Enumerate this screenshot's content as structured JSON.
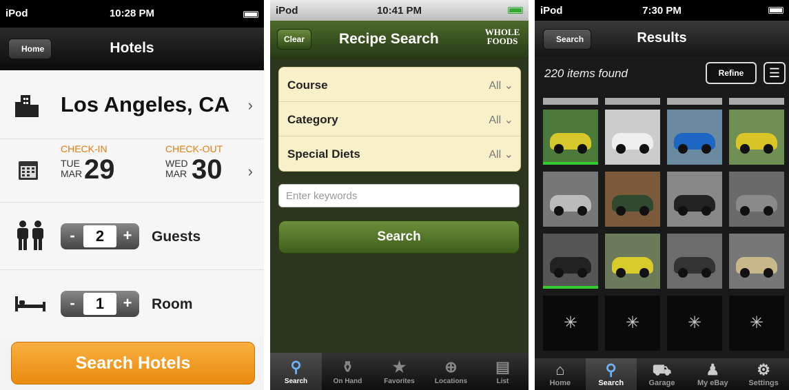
{
  "hotels": {
    "status": {
      "device": "iPod",
      "time": "10:28 PM"
    },
    "nav": {
      "back": "Home",
      "title": "Hotels"
    },
    "location": "Los Angeles, CA",
    "checkin": {
      "label": "CHECK-IN",
      "dow": "TUE",
      "month": "MAR",
      "day": "29"
    },
    "checkout": {
      "label": "CHECK-OUT",
      "dow": "WED",
      "month": "MAR",
      "day": "30"
    },
    "guests": {
      "value": "2",
      "label": "Guests",
      "minus": "-",
      "plus": "+"
    },
    "rooms": {
      "value": "1",
      "label": "Room",
      "minus": "-",
      "plus": "+"
    },
    "search_button": "Search Hotels"
  },
  "recipes": {
    "status": {
      "device": "iPod",
      "time": "10:41 PM"
    },
    "nav": {
      "clear": "Clear",
      "title": "Recipe Search",
      "logo": "WHOLE FOODS"
    },
    "filters": [
      {
        "label": "Course",
        "value": "All"
      },
      {
        "label": "Category",
        "value": "All"
      },
      {
        "label": "Special Diets",
        "value": "All"
      }
    ],
    "keyword_placeholder": "Enter keywords",
    "search_button": "Search",
    "tabs": [
      {
        "label": "Search",
        "icon": "search-icon",
        "glyph": "⚲"
      },
      {
        "label": "On Hand",
        "icon": "pantry-icon",
        "glyph": "⚱"
      },
      {
        "label": "Favorites",
        "icon": "star-icon",
        "glyph": "★"
      },
      {
        "label": "Locations",
        "icon": "globe-icon",
        "glyph": "⊕"
      },
      {
        "label": "List",
        "icon": "list-icon",
        "glyph": "▤"
      }
    ]
  },
  "ebay": {
    "status": {
      "device": "iPod",
      "time": "7:30 PM"
    },
    "nav": {
      "back": "Search",
      "title": "Results"
    },
    "found": "220 items found",
    "refine": "Refine",
    "tabs": [
      {
        "label": "Home",
        "icon": "home-icon",
        "glyph": "⌂"
      },
      {
        "label": "Search",
        "icon": "search-icon",
        "glyph": "⚲"
      },
      {
        "label": "Garage",
        "icon": "car-icon",
        "glyph": "⛟"
      },
      {
        "label": "My eBay",
        "icon": "person-icon",
        "glyph": "♟"
      },
      {
        "label": "Settings",
        "icon": "gear-icon",
        "glyph": "⚙"
      }
    ]
  }
}
